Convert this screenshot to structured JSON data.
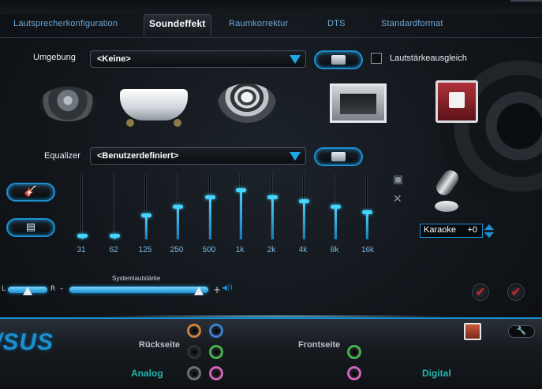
{
  "tabs": [
    {
      "label": "Lautsprecherkonfiguration"
    },
    {
      "label": "Soundeffekt"
    },
    {
      "label": "Raumkorrektur"
    },
    {
      "label": "DTS"
    },
    {
      "label": "Standardformat"
    }
  ],
  "environment": {
    "label": "Umgebung",
    "selected": "<Keine>",
    "loudness_label": "Lautstärkeausgleich",
    "loudness_checked": false,
    "presets": [
      "disc-icon",
      "bathtub-icon",
      "arena-icon",
      "room-icon",
      "theater-icon"
    ]
  },
  "equalizer": {
    "label": "Equalizer",
    "selected": "<Benutzerdefiniert>",
    "bands": [
      {
        "label": "31",
        "level": 0.03
      },
      {
        "label": "62",
        "level": 0.03
      },
      {
        "label": "125",
        "level": 0.36
      },
      {
        "label": "250",
        "level": 0.5
      },
      {
        "label": "500",
        "level": 0.64
      },
      {
        "label": "1k",
        "level": 0.76
      },
      {
        "label": "2k",
        "level": 0.65
      },
      {
        "label": "4k",
        "level": 0.58
      },
      {
        "label": "8k",
        "level": 0.5
      },
      {
        "label": "16k",
        "level": 0.4
      }
    ]
  },
  "karaoke": {
    "label": "Karaoke",
    "value": "+0"
  },
  "volume": {
    "balance_left": "L",
    "balance_right": "R",
    "master_label": "Systemlautstärke",
    "minus": "–",
    "plus": "+",
    "level": 0.93
  },
  "bottom": {
    "brand": "/SUS",
    "rear_label": "Rückseite",
    "front_label": "Frontseite",
    "analog_label": "Analog",
    "digital_label": "Digital",
    "colors": {
      "orange": "#c8803f",
      "blue": "#3b7fd0",
      "black": "#2e3134",
      "green": "#47b34a",
      "gray": "#6b7075",
      "pink": "#d063b8"
    }
  }
}
